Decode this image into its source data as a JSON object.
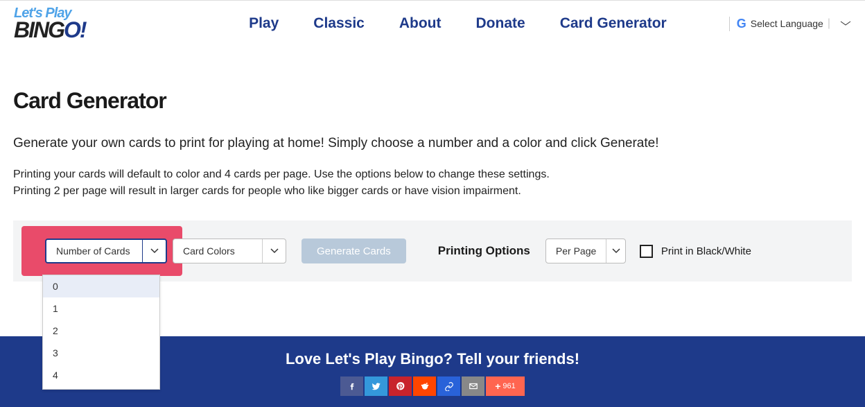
{
  "header": {
    "logo_top": "Let's Play",
    "logo_bottom_pre": "BING",
    "logo_bottom_o": "O",
    "logo_bottom_excl": "!",
    "nav": [
      "Play",
      "Classic",
      "About",
      "Donate",
      "Card Generator"
    ],
    "lang": "Select Language"
  },
  "main": {
    "title": "Card Generator",
    "intro1": "Generate your own cards to print for playing at home! Simply choose a number and a color and click Generate!",
    "intro2a": "Printing your cards will default to color and 4 cards per page. Use the options below to change these settings.",
    "intro2b": "Printing 2 per page will result in larger cards for people who like bigger cards or have vision impairment."
  },
  "controls": {
    "num_label": "Number of Cards",
    "color_label": "Card Colors",
    "gen_label": "Generate Cards",
    "print_options": "Printing Options",
    "perpage_label": "Per Page",
    "bw_label": "Print in Black/White",
    "dropdown": [
      "0",
      "1",
      "2",
      "3",
      "4"
    ]
  },
  "footer": {
    "title": "Love Let's Play Bingo? Tell your friends!",
    "share_count": "961"
  }
}
